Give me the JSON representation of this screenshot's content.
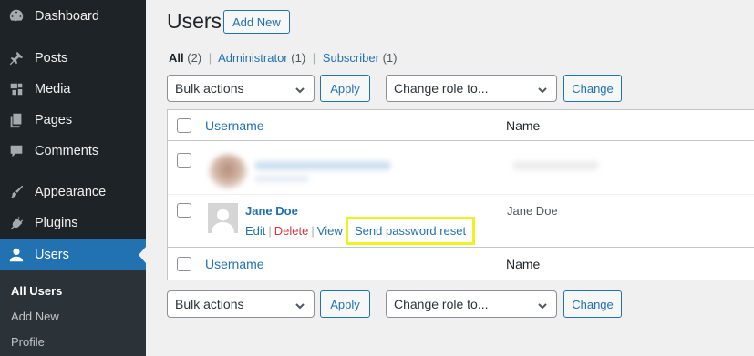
{
  "sidebar": {
    "items": [
      {
        "label": "Dashboard",
        "icon": "dashboard-icon"
      },
      {
        "label": "Posts",
        "icon": "pin-icon"
      },
      {
        "label": "Media",
        "icon": "media-icon"
      },
      {
        "label": "Pages",
        "icon": "pages-icon"
      },
      {
        "label": "Comments",
        "icon": "comment-icon"
      },
      {
        "label": "Appearance",
        "icon": "brush-icon"
      },
      {
        "label": "Plugins",
        "icon": "plug-icon"
      },
      {
        "label": "Users",
        "icon": "user-icon",
        "active": true
      }
    ],
    "submenu": [
      "All Users",
      "Add New",
      "Profile"
    ]
  },
  "header": {
    "title": "Users",
    "add_new": "Add New"
  },
  "filters": {
    "all": "All",
    "all_count": "(2)",
    "admin": "Administrator",
    "admin_count": "(1)",
    "subscriber": "Subscriber",
    "subscriber_count": "(1)",
    "sep": "|"
  },
  "top_controls": {
    "bulk_actions": "Bulk actions",
    "apply": "Apply",
    "change_role": "Change role to...",
    "change": "Change"
  },
  "bottom_controls": {
    "bulk_actions": "Bulk actions",
    "apply": "Apply",
    "change_role": "Change role to...",
    "change": "Change"
  },
  "table": {
    "col_username": "Username",
    "col_name": "Name",
    "row2": {
      "username": "Jane Doe",
      "name": "Jane Doe",
      "actions": {
        "edit": "Edit",
        "delete": "Delete",
        "view": "View",
        "send_reset": "Send password reset"
      }
    }
  },
  "colors": {
    "sidebar_bg": "#1d2327",
    "active_bg": "#2271b1",
    "link": "#2271b1",
    "delete": "#d63638",
    "highlight": "#eef21f"
  }
}
